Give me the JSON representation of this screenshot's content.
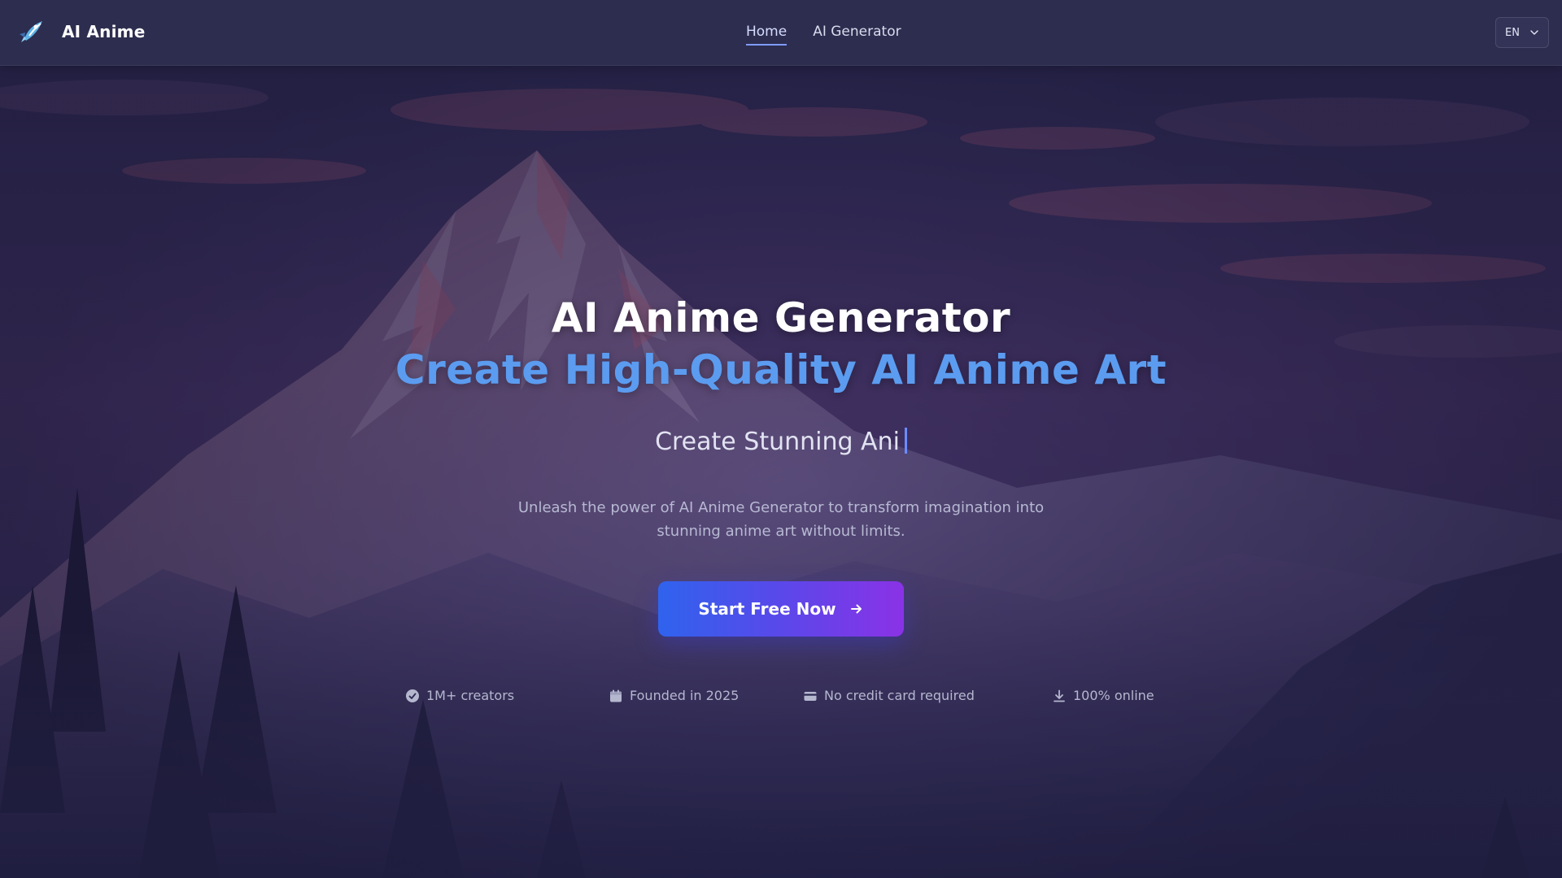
{
  "brand": {
    "name": "AI Anime",
    "logo_icon": "rocket-logo-icon"
  },
  "nav": {
    "links": [
      {
        "label": "Home",
        "active": true
      },
      {
        "label": "AI Generator",
        "active": false
      }
    ]
  },
  "language": {
    "selected": "EN",
    "icon": "chevron-down-icon"
  },
  "hero": {
    "title": "AI Anime Generator",
    "subtitle": "Create High-Quality AI Anime Art",
    "typewriter_text": "Create Stunning Ani",
    "description_line1": "Unleash the power of AI Anime Generator to transform imagination into",
    "description_line2": "stunning anime art without limits.",
    "cta_label": "Start Free Now",
    "cta_icon": "arrow-right-icon"
  },
  "stats": [
    {
      "icon": "check-circle-icon",
      "label": "1M+ creators"
    },
    {
      "icon": "calendar-icon",
      "label": "Founded in 2025"
    },
    {
      "icon": "credit-card-icon",
      "label": "No credit card required"
    },
    {
      "icon": "download-icon",
      "label": "100% online"
    }
  ],
  "colors": {
    "accent_blue": "#5b9cf0",
    "cta_gradient_start": "#2f63ee",
    "cta_gradient_end": "#8a32e6",
    "navbar_bg": "#2e2e50"
  }
}
